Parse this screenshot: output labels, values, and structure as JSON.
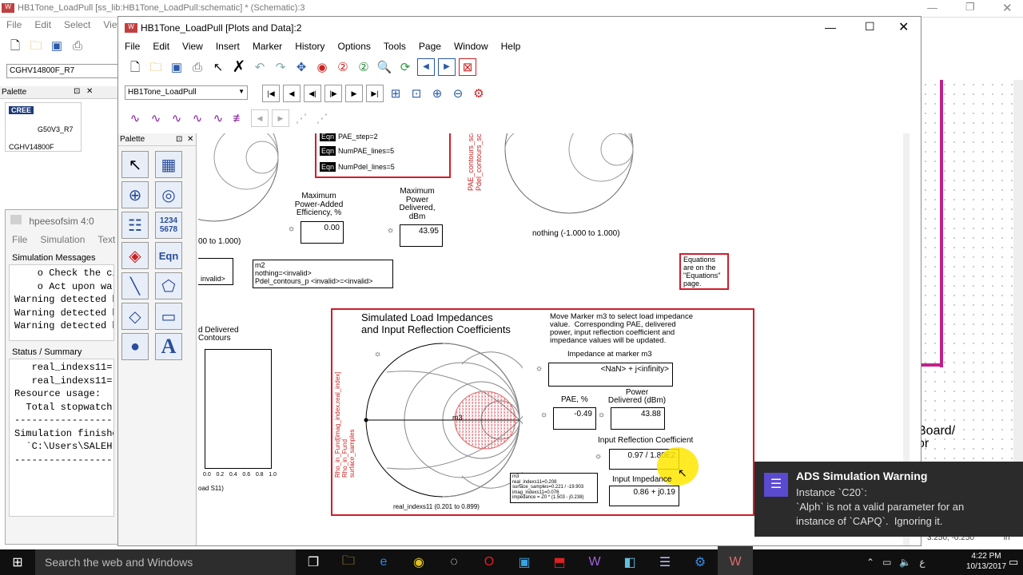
{
  "schematic": {
    "title": "HB1Tone_LoadPull [ss_lib:HB1Tone_LoadPull:schematic] * (Schematic):3",
    "menu": [
      "File",
      "Edit",
      "Select",
      "View"
    ],
    "component_field": "CGHV14800F_R7",
    "palette_title": "Palette",
    "cree_logo": "CREE",
    "part_label_1": "G50V3_R7",
    "part_label_2": "CGHV14800F",
    "board_text": "Board/\nor",
    "coords": "3.250, -0.250",
    "unit": "in"
  },
  "sim": {
    "title": "hpeesofsim 4:0",
    "menu": [
      "File",
      "Simulation",
      "Text"
    ],
    "messages_label": "Simulation Messages",
    "messages": [
      "    o Check the ci",
      "    o Act upon wa",
      "Warning detected b",
      "Warning detected b",
      "Warning detected b"
    ],
    "status_label": "Status / Summary",
    "status": [
      "   real_indexs11=",
      "   real_indexs11=",
      "",
      "Resource usage:",
      "  Total stopwatch",
      "",
      "-----------------",
      "Simulation finishe",
      "  `C:\\Users\\SALEH`",
      "-----------------"
    ]
  },
  "main": {
    "title": "HB1Tone_LoadPull [Plots and Data]:2",
    "menu": [
      "File",
      "Edit",
      "View",
      "Insert",
      "Marker",
      "History",
      "Options",
      "Tools",
      "Page",
      "Window",
      "Help"
    ],
    "dataset": "HB1Tone_LoadPull",
    "palette_title": "Palette",
    "palette_num": "1234\n5678",
    "palette_eqn": "Eqn",
    "palette_text": "A",
    "eqn_tag": "Eqn",
    "eqn_lines": [
      "PAE_step=2",
      "NumPAE_lines=5",
      "NumPdel_lines=5"
    ],
    "max_pae_label": "Maximum\nPower-Added\nEfficiency, %",
    "max_pae_value": "0.00",
    "max_pdel_label": "Maximum\nPower\nDelivered,\ndBm",
    "max_pdel_value": "43.95",
    "smith1_range": "00 to 1.000)",
    "smith2_range": "nothing (-1.000 to 1.000)",
    "smith2_vert": "PAE_contours_scale\nPdel_contours_scale",
    "invalid_small": "invalid>",
    "m2_text": "m2\nnothing=<invalid>\nPdel_contours_p <invalid>=<invalid>",
    "eq_note": "Equations\nare on the\n\"Equations\"\npage.",
    "pdel_contours_title": "d Delivered\nContours",
    "left_axis_ticks": [
      "0.0",
      "0.2",
      "0.4",
      "0.6",
      "0.8",
      "1.0"
    ],
    "left_bottom_label": "oad S11)",
    "sim_title": "Simulated Load Impedances\nand Input Reflection Coefficients",
    "instructions": "Move Marker m3 to select load impedance\nvalue.  Corresponding PAE, delivered\npower, input reflection coefficient and\nimpedance values will be updated.",
    "imp_marker_label": "Impedance at marker m3",
    "imp_marker_value": "<NaN> + j<infinity>",
    "pae_label": "PAE, %",
    "pae_value": "-0.49",
    "pdel_label": "Power\nDelivered (dBm)",
    "pdel_value": "43.88",
    "irc_label": "Input Reflection Coefficient",
    "irc_value": "0.97 / 1.80E2",
    "iimp_label": "Input Impedance",
    "iimp_value": "0.86 + j0.19",
    "smith3_vert": "Rho_in_Fund[imag_index,real_index]\nRho_in_Fund\nsurface_samples",
    "smith3_range": "real_indexs11 (0.201 to 0.899)",
    "marker_m3": "m3",
    "m3_box": "m3\nreal_indexs11=0.208\nsurface_samples=0.221 / -19.903\nimag_indexs11=0.076\nimpedance = Z0 * (1.503 - j0.238)"
  },
  "toast": {
    "title": "ADS Simulation Warning",
    "body": "Instance `C20`:\n`Alph` is not a valid parameter for an\ninstance of `CAPQ`.  Ignoring it."
  },
  "taskbar": {
    "search": "Search the web and Windows",
    "time": "4:22 PM",
    "date": "10/13/2017",
    "lang": "ع"
  },
  "colors": {
    "accent_red": "#d21c2a",
    "toast_bg": "#2b2b2b",
    "taskbar_bg": "#101010",
    "magenta": "#c0208c"
  }
}
